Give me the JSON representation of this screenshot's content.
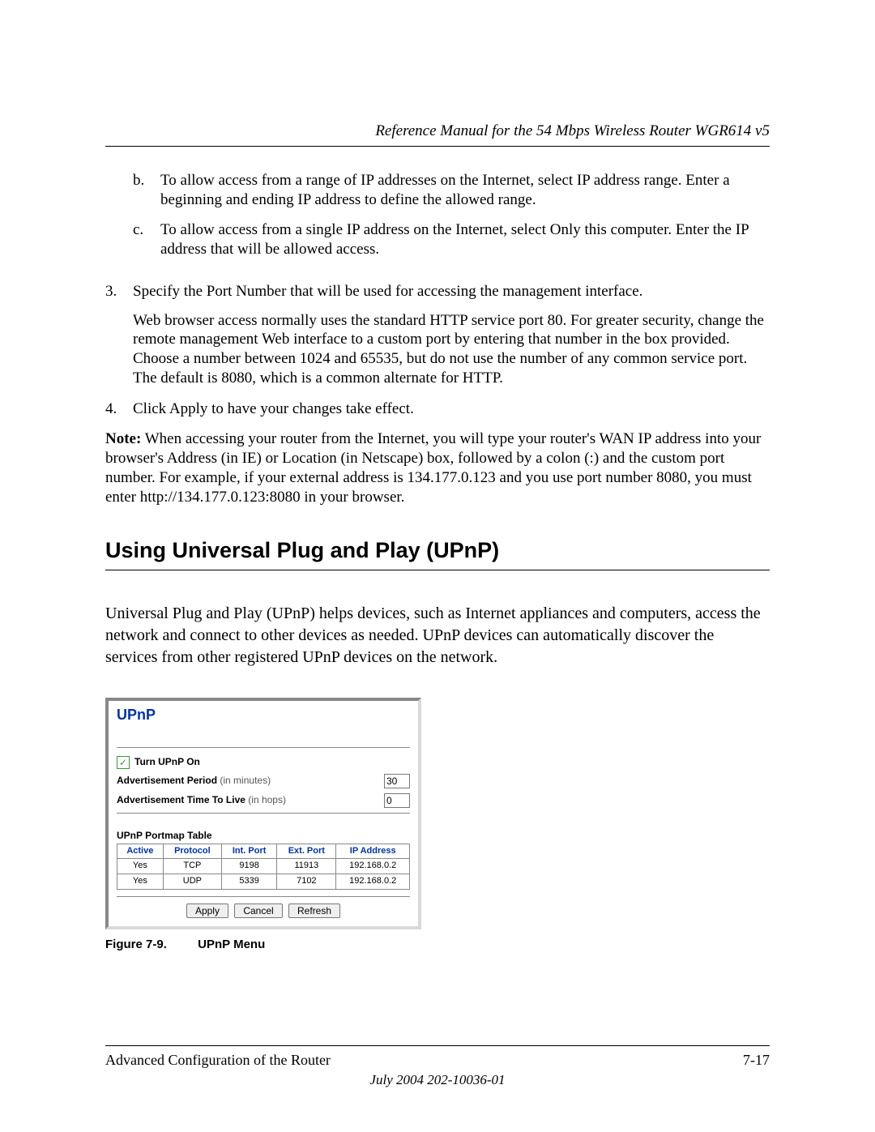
{
  "header": {
    "running_title": "Reference Manual for the 54 Mbps Wireless Router WGR614 v5"
  },
  "list": {
    "sub_b_marker": "b.",
    "sub_b_text": "To allow access from a range of IP addresses on the Internet, select IP address range. Enter a beginning and ending IP address to define the allowed range.",
    "sub_c_marker": "c.",
    "sub_c_text": "To allow access from a single IP address on the Internet, select Only this computer. Enter the IP address that will be allowed access.",
    "item3_marker": "3.",
    "item3_text": "Specify the Port Number that will be used for accessing the management interface.",
    "item3_para": "Web browser access normally uses the standard HTTP service port 80. For greater security, change the remote management Web interface to a custom port by entering that number in the box provided. Choose a number between 1024 and 65535, but do not use the number of any common service port. The default is 8080, which is a common alternate for HTTP.",
    "item4_marker": "4.",
    "item4_text": "Click Apply to have your changes take effect."
  },
  "note": {
    "label": "Note:",
    "text": " When accessing your router from the Internet, you will type your router's WAN IP address into your browser's Address (in IE) or Location (in Netscape) box, followed by a colon (:) and the custom port number. For example, if your external address is 134.177.0.123 and you use port number 8080, you must enter http://134.177.0.123:8080 in your browser."
  },
  "section": {
    "heading": "Using Universal Plug and Play (UPnP)",
    "intro": "Universal Plug and Play (UPnP) helps devices, such as Internet appliances and computers, access the network and connect to other devices as needed. UPnP devices can automatically discover the services from other registered UPnP devices on the network."
  },
  "upnp": {
    "title": "UPnP",
    "turn_on_label": "Turn UPnP On",
    "turn_on_checked": true,
    "adv_period_label": "Advertisement Period",
    "adv_period_hint": "(in minutes)",
    "adv_period_value": "30",
    "adv_ttl_label": "Advertisement Time To Live",
    "adv_ttl_hint": "(in hops)",
    "adv_ttl_value": "0",
    "portmap_title": "UPnP Portmap Table",
    "columns": {
      "active": "Active",
      "protocol": "Protocol",
      "int_port": "Int. Port",
      "ext_port": "Ext. Port",
      "ip": "IP Address"
    },
    "rows": [
      {
        "active": "Yes",
        "protocol": "TCP",
        "int_port": "9198",
        "ext_port": "11913",
        "ip": "192.168.0.2"
      },
      {
        "active": "Yes",
        "protocol": "UDP",
        "int_port": "5339",
        "ext_port": "7102",
        "ip": "192.168.0.2"
      }
    ],
    "buttons": {
      "apply": "Apply",
      "cancel": "Cancel",
      "refresh": "Refresh"
    }
  },
  "figure": {
    "number": "Figure 7-9.",
    "title": "UPnP Menu"
  },
  "footer": {
    "section": "Advanced Configuration of the Router",
    "page": "7-17",
    "date": "July 2004 202-10036-01"
  }
}
